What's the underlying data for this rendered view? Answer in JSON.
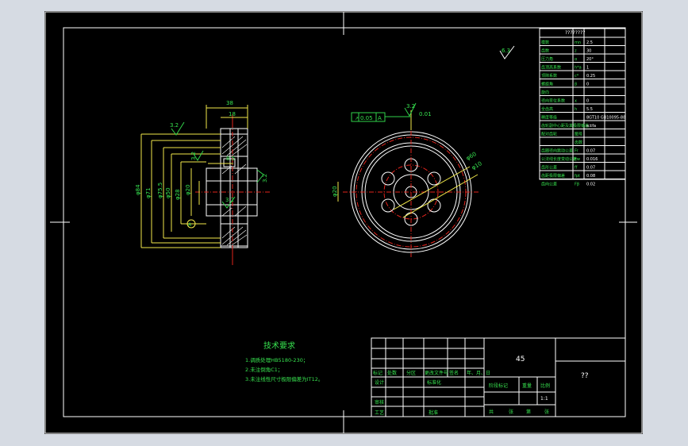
{
  "drawing": {
    "tech_req_title": "技术要求",
    "tech_req_items": [
      "1.调质处理HB5180-230；",
      "2.未注倒角C1；",
      "3.未注线性尺寸极限偏差为IT12。"
    ],
    "roughness_global": "6.3"
  },
  "param_table": {
    "header": "????????",
    "rows": [
      {
        "name": "模数",
        "sym": "mn",
        "val": "2.5"
      },
      {
        "name": "齿数",
        "sym": "z",
        "val": "30"
      },
      {
        "name": "压力角",
        "sym": "α",
        "val": "20°"
      },
      {
        "name": "齿顶高系数",
        "sym": "h*a",
        "val": "1"
      },
      {
        "name": "顶隙系数",
        "sym": "c*",
        "val": "0.25"
      },
      {
        "name": "螺旋角",
        "sym": "β",
        "val": "0"
      },
      {
        "name": "旋向",
        "sym": "",
        "val": ""
      },
      {
        "name": "径向变位系数",
        "sym": "x",
        "val": "0"
      },
      {
        "name": "全齿高",
        "sym": "h",
        "val": "5.5"
      },
      {
        "name": "精度等级",
        "sym": "",
        "val": "8GT10 GB10095-88"
      },
      {
        "name": "齿轮副中心距及其极限偏差",
        "sym": "",
        "val": "a±fa"
      },
      {
        "name": "配对齿轮",
        "sym": "图号",
        "val": ""
      },
      {
        "name": "",
        "sym": "齿数",
        "val": ""
      },
      {
        "name": "齿圈径向跳动公差",
        "sym": "Fr",
        "val": "0.07"
      },
      {
        "name": "公法线长度变动公差",
        "sym": "Fw",
        "val": "0.016"
      },
      {
        "name": "齿形公差",
        "sym": "ff",
        "val": "0.07"
      },
      {
        "name": "齿距极限偏差",
        "sym": "fpt",
        "val": "0.08"
      },
      {
        "name": "齿向公差",
        "sym": "Fβ",
        "val": "0.02"
      }
    ]
  },
  "dims": {
    "width_top": "38",
    "width_hub": "18",
    "keyway": "8.5",
    "d_a": "φ84",
    "d_f": "φ71",
    "d_rim": "φ75.5",
    "d_web": "φ50",
    "d_hub": "φ28",
    "d_bore": "φ20",
    "r_holes": "φ60",
    "r_hole_d": "φ10",
    "bore_front": "φ20",
    "roughness": "3.2",
    "tolerance_frame": "0.05",
    "datum": "A",
    "runout": "0.01",
    "marker": "2"
  },
  "title_block": {
    "material": "45",
    "drawing_name": "??",
    "labels": [
      "标记",
      "处数",
      "分区",
      "更改文件号",
      "签名",
      "年、月、日"
    ],
    "design": "设计",
    "standard": "标准化",
    "review": "审核",
    "process": "工艺",
    "approve": "批准",
    "stage": "阶段标记",
    "weight": "重量",
    "scale": "比例",
    "scale_val": "1:1",
    "sheets": [
      "共",
      "张",
      "第",
      "张"
    ]
  }
}
